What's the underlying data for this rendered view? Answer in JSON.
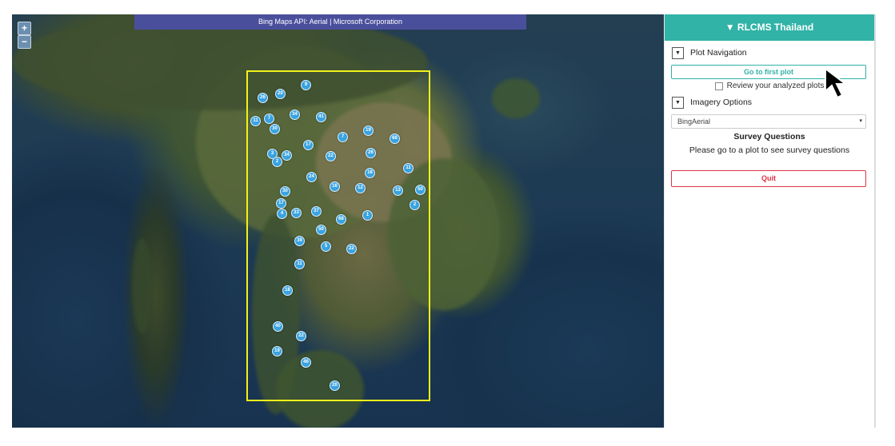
{
  "map": {
    "attribution": "Bing Maps API: Aerial | Microsoft Corporation",
    "zoom_in_label": "+",
    "zoom_out_label": "−",
    "markers": [
      "9",
      "20",
      "26",
      "34",
      "41",
      "7",
      "30",
      "11",
      "17",
      "7",
      "19",
      "68",
      "3",
      "34",
      "2",
      "22",
      "26",
      "11",
      "24",
      "18",
      "12",
      "16",
      "13",
      "50",
      "30",
      "17",
      "4",
      "33",
      "37",
      "68",
      "1",
      "2",
      "50",
      "39",
      "5",
      "22",
      "11",
      "18",
      "40",
      "22",
      "19",
      "46",
      "20"
    ]
  },
  "panel": {
    "header": "▼ RLCMS Thailand",
    "plot_nav_toggle": "▼",
    "plot_nav_title": "Plot Navigation",
    "first_plot_button": "Go to first plot",
    "review_label": "Review your analyzed plots",
    "imagery_toggle": "▼",
    "imagery_title": "Imagery Options",
    "imagery_select": "BingAerial",
    "imagery_caret": "▾",
    "survey_title": "Survey Questions",
    "survey_message": "Please go to a plot to see survey questions",
    "quit_button": "Quit"
  },
  "colors": {
    "accent": "#31b3a7",
    "danger": "#dc3545",
    "marker": "#3aa3e0",
    "bbox": "#f1f11a"
  }
}
